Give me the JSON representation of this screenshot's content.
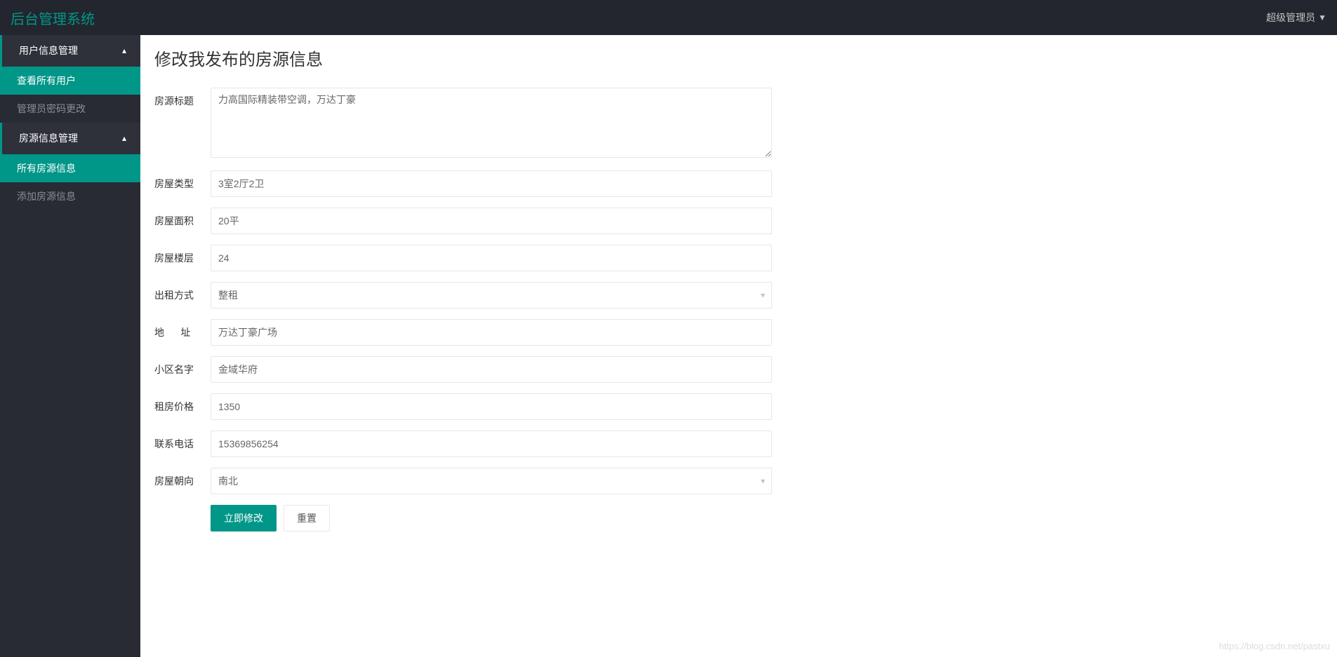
{
  "header": {
    "logo": "后台管理系统",
    "user_label": "超级管理员"
  },
  "sidebar": {
    "menus": [
      {
        "label": "用户信息管理",
        "items": [
          {
            "label": "查看所有用户",
            "active": true
          },
          {
            "label": "管理员密码更改",
            "active": false
          }
        ]
      },
      {
        "label": "房源信息管理",
        "items": [
          {
            "label": "所有房源信息",
            "active": true
          },
          {
            "label": "添加房源信息",
            "active": false
          }
        ]
      }
    ]
  },
  "page": {
    "title": "修改我发布的房源信息"
  },
  "form": {
    "title_label": "房源标题",
    "title_value": "力高国际精装带空调，万达丁豪",
    "type_label": "房屋类型",
    "type_value": "3室2厅2卫",
    "area_label": "房屋面积",
    "area_value": "20平",
    "floor_label": "房屋楼层",
    "floor_value": "24",
    "rent_mode_label": "出租方式",
    "rent_mode_value": "整租",
    "address_label_start": "地",
    "address_label_end": "址",
    "address_value": "万达丁豪广场",
    "community_label": "小区名字",
    "community_value": "金域华府",
    "price_label": "租房价格",
    "price_value": "1350",
    "phone_label": "联系电话",
    "phone_value": "15369856254",
    "orientation_label": "房屋朝向",
    "orientation_value": "南北",
    "submit_label": "立即修改",
    "reset_label": "重置"
  },
  "watermark": "https://blog.csdn.net/pastxu"
}
